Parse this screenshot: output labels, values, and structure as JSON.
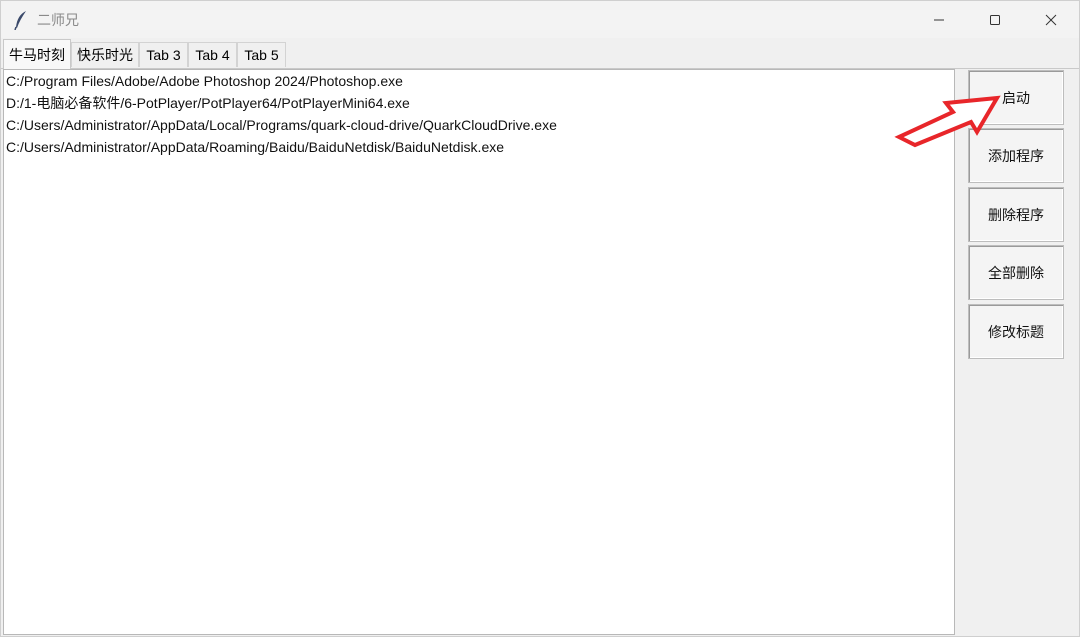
{
  "window": {
    "title": "二师兄",
    "icon": "feather-icon"
  },
  "tabs": [
    {
      "label": "牛马时刻",
      "active": true
    },
    {
      "label": "快乐时光",
      "active": false
    },
    {
      "label": "Tab 3",
      "active": false
    },
    {
      "label": "Tab 4",
      "active": false
    },
    {
      "label": "Tab 5",
      "active": false
    }
  ],
  "list": {
    "items": [
      "C:/Program Files/Adobe/Adobe Photoshop 2024/Photoshop.exe",
      "D:/1-电脑必备软件/6-PotPlayer/PotPlayer64/PotPlayerMini64.exe",
      "C:/Users/Administrator/AppData/Local/Programs/quark-cloud-drive/QuarkCloudDrive.exe",
      "C:/Users/Administrator/AppData/Roaming/Baidu/BaiduNetdisk/BaiduNetdisk.exe"
    ]
  },
  "buttons": {
    "launch": "启动",
    "add_program": "添加程序",
    "delete_program": "删除程序",
    "delete_all": "全部删除",
    "edit_title": "修改标题"
  },
  "colors": {
    "annotation_arrow": "#e8262a"
  }
}
